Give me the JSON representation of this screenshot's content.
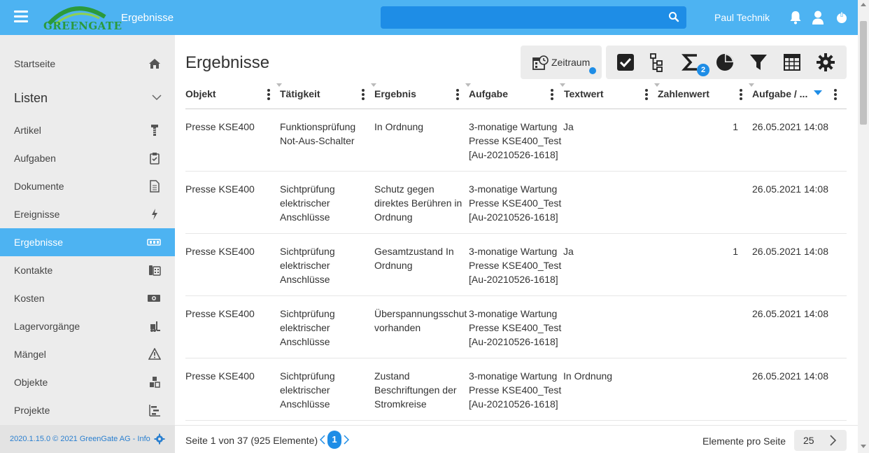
{
  "header": {
    "logo_text": "GREENGATE",
    "title": "Ergebnisse",
    "search_value": "",
    "username": "Paul Technik",
    "accent_color": "#4db3f2",
    "icons": [
      "menu-icon",
      "bell-icon",
      "user-icon",
      "power-icon"
    ]
  },
  "sidebar": {
    "home": "Startseite",
    "section_title": "Listen",
    "items": [
      {
        "label": "Artikel",
        "icon": "screw-icon"
      },
      {
        "label": "Aufgaben",
        "icon": "clipboard-icon"
      },
      {
        "label": "Dokumente",
        "icon": "document-icon"
      },
      {
        "label": "Ereignisse",
        "icon": "lightning-icon"
      },
      {
        "label": "Ergebnisse",
        "icon": "result-icon",
        "active": true
      },
      {
        "label": "Kontakte",
        "icon": "phone-icon"
      },
      {
        "label": "Kosten",
        "icon": "money-icon"
      },
      {
        "label": "Lagervorgänge",
        "icon": "forklift-icon"
      },
      {
        "label": "Mängel",
        "icon": "warning-icon"
      },
      {
        "label": "Objekte",
        "icon": "cubes-icon"
      },
      {
        "label": "Projekte",
        "icon": "gantt-icon"
      }
    ],
    "footer": "2020.1.15.0 © 2021 GreenGate AG - Info"
  },
  "main": {
    "title": "Ergebnisse",
    "zeitraum_label": "Zeitraum",
    "sum_badge": "2",
    "columns": [
      "Objekt",
      "Tätigkeit",
      "Ergebnis",
      "Aufgabe",
      "Textwert",
      "Zahlenwert",
      "Aufgabe / ..."
    ],
    "rows": [
      {
        "objekt": "Presse KSE400",
        "taetigkeit": "Funktionsprüfung Not-Aus-Schalter",
        "ergebnis": "In Ordnung",
        "aufgabe": "3-monatige Wartung Presse KSE400_Test [Au-20210526-1618]",
        "textwert": "Ja",
        "zahlenwert": "1",
        "datum": "26.05.2021 14:08"
      },
      {
        "objekt": "Presse KSE400",
        "taetigkeit": "Sichtprüfung elektrischer Anschlüsse",
        "ergebnis": "Schutz gegen direktes Berühren in Ordnung",
        "aufgabe": "3-monatige Wartung Presse KSE400_Test [Au-20210526-1618]",
        "textwert": "",
        "zahlenwert": "",
        "datum": "26.05.2021 14:08"
      },
      {
        "objekt": "Presse KSE400",
        "taetigkeit": "Sichtprüfung elektrischer Anschlüsse",
        "ergebnis": "Gesamtzustand In Ordnung",
        "aufgabe": "3-monatige Wartung Presse KSE400_Test [Au-20210526-1618]",
        "textwert": "Ja",
        "zahlenwert": "1",
        "datum": "26.05.2021 14:08"
      },
      {
        "objekt": "Presse KSE400",
        "taetigkeit": "Sichtprüfung elektrischer Anschlüsse",
        "ergebnis": "Überspannungsschutz vorhanden",
        "aufgabe": "3-monatige Wartung Presse KSE400_Test [Au-20210526-1618]",
        "textwert": "",
        "zahlenwert": "",
        "datum": "26.05.2021 14:08"
      },
      {
        "objekt": "Presse KSE400",
        "taetigkeit": "Sichtprüfung elektrischer Anschlüsse",
        "ergebnis": "Zustand Beschriftungen der Stromkreise",
        "aufgabe": "3-monatige Wartung Presse KSE400_Test [Au-20210526-1618]",
        "textwert": "In Ordnung",
        "zahlenwert": "",
        "datum": "26.05.2021 14:08"
      }
    ]
  },
  "pager": {
    "info": "Seite 1 von 37 (925 Elemente)",
    "current_page": "1",
    "per_page_label": "Elemente pro Seite",
    "per_page_value": "25"
  }
}
